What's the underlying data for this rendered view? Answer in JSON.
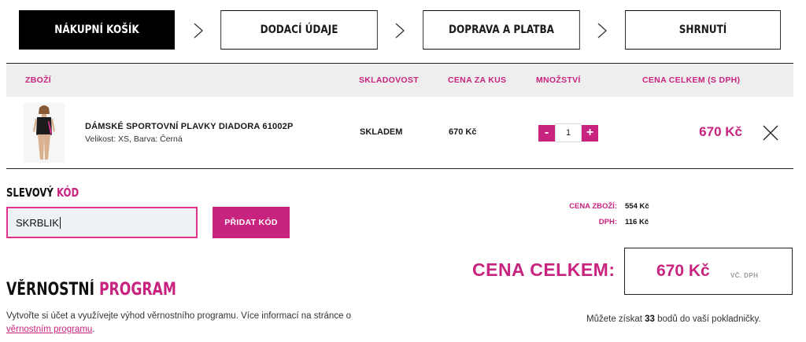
{
  "steps": [
    {
      "label": "NÁKUPNÍ KOŠÍK",
      "active": true
    },
    {
      "label": "DODACÍ ÚDAJE",
      "active": false
    },
    {
      "label": "DOPRAVA A PLATBA",
      "active": false
    },
    {
      "label": "SHRNUTÍ",
      "active": false
    }
  ],
  "table": {
    "headers": {
      "item": "ZBOŽÍ",
      "stock": "SKLADOVOST",
      "unit_price": "CENA ZA KUS",
      "quantity": "MNOŽSTVÍ",
      "total": "CENA CELKEM (S DPH)"
    }
  },
  "item": {
    "name": "DÁMSKÉ SPORTOVNÍ PLAVKY DIADORA 61002P",
    "variant": "Velikost: XS, Barva: Černá",
    "stock": "SKLADEM",
    "unit_price": "670 Kč",
    "quantity": "1",
    "minus": "-",
    "plus": "+",
    "total": "670 Kč",
    "image_icon": "swimsuit-photo",
    "remove_icon": "close-icon"
  },
  "discount": {
    "title_a": "SLEVOVÝ",
    "title_b": "KÓD",
    "value": "SKRBLIK",
    "button": "PŘIDAT KÓD"
  },
  "summary": {
    "goods_label": "CENA ZBOŽÍ:",
    "goods_value": "554 Kč",
    "vat_label": "DPH:",
    "vat_value": "116 Kč",
    "grand_label": "CENA CELKEM:",
    "grand_value": "670 Kč",
    "grand_vat_note": "VČ. DPH"
  },
  "loyalty": {
    "title_a": "VĚRNOSTNÍ",
    "title_b": "PROGRAM",
    "text": "Vytvořte si účet a využívejte výhod věrnostního programu. Více informací na stránce o ",
    "link": "věrnostním programu",
    "text_end": ".",
    "points_prefix": "Můžete získat ",
    "points_value": "33",
    "points_suffix": " bodů do vaší pokladničky."
  },
  "colors": {
    "accent": "#c8237f",
    "header_bg": "#eeeeee",
    "active_step_bg": "#000000"
  }
}
